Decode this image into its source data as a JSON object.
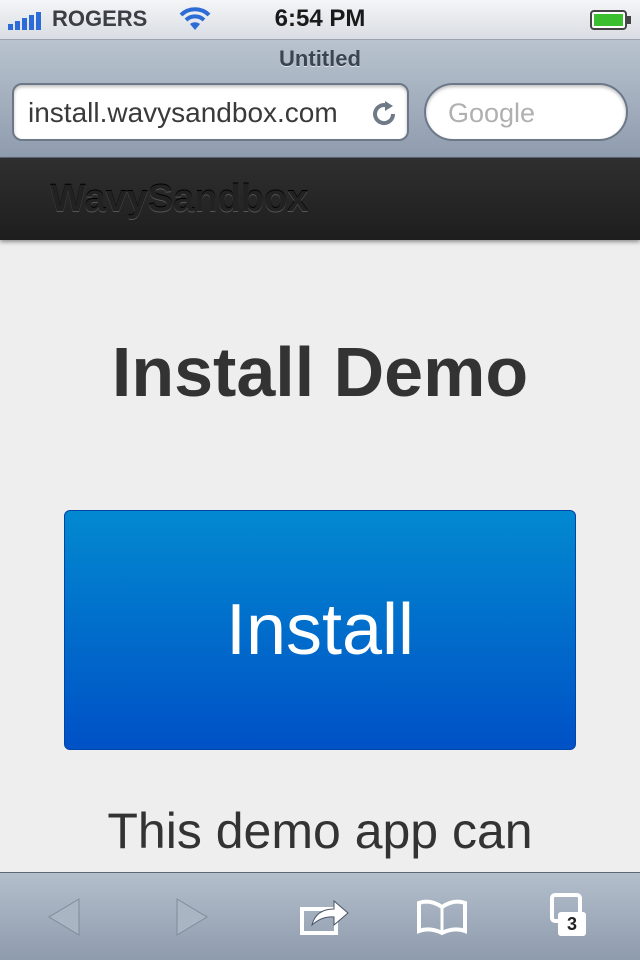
{
  "status_bar": {
    "carrier": "ROGERS",
    "time": "6:54 PM"
  },
  "browser": {
    "page_title": "Untitled",
    "url": "install.wavysandbox.com",
    "search_placeholder": "Google"
  },
  "site": {
    "brand": "WavySandbox"
  },
  "main": {
    "heading": "Install Demo",
    "install_button_label": "Install",
    "description": "This demo app can"
  },
  "toolbar": {
    "tabs_count": "3"
  },
  "colors": {
    "install_button_top": "#0289d0",
    "install_button_bottom": "#0051c6",
    "header_bg": "#2a2a2a",
    "page_bg": "#eeeeee"
  },
  "icons": [
    "signal-icon",
    "wifi-icon",
    "battery-icon",
    "reload-icon",
    "back-icon",
    "forward-icon",
    "share-icon",
    "bookmarks-icon",
    "tabs-icon"
  ]
}
